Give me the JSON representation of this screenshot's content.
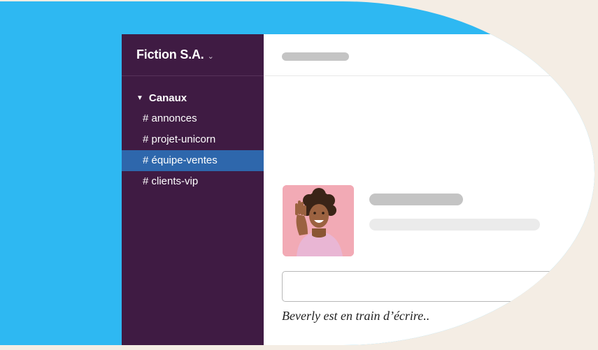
{
  "workspace": {
    "name": "Fiction S.A.",
    "chevron": "⌄"
  },
  "sidebar": {
    "section_toggle": "▼",
    "section_label": "Canaux",
    "channels": [
      {
        "label": "# annonces",
        "active": false
      },
      {
        "label": "# projet-unicorn",
        "active": false
      },
      {
        "label": "# équipe-ventes",
        "active": true
      },
      {
        "label": "# clients-vip",
        "active": false
      }
    ]
  },
  "message": {
    "avatar": "woman-waving-avatar"
  },
  "composer": {
    "placeholder": "",
    "typing_indicator": "Beverly est en train d’écrire.."
  },
  "colors": {
    "background_blob": "#2eb8f2",
    "page_bg": "#f4ede4",
    "sidebar_bg": "#3f1b43",
    "active_channel": "#2e67ac",
    "placeholder_dark": "#c4c4c4",
    "placeholder_light": "#ebebeb"
  }
}
